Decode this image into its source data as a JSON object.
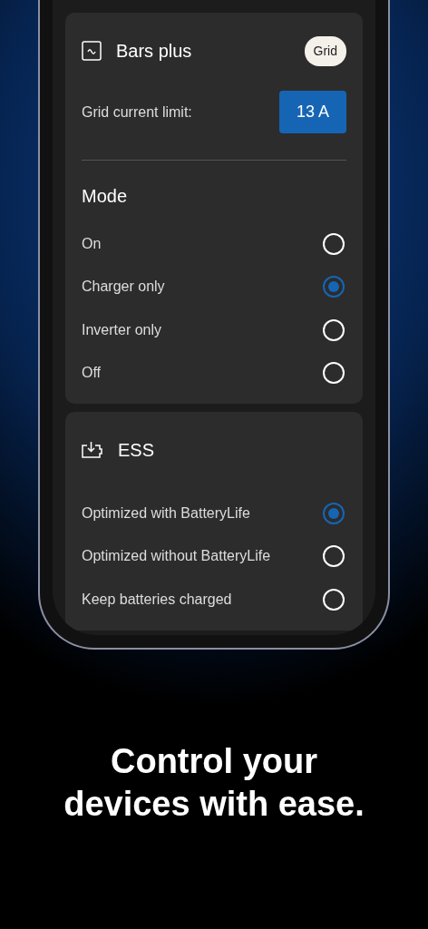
{
  "device": {
    "title": "Bars plus",
    "tag": "Grid",
    "limit_label": "Grid current limit:",
    "limit_value": "13 A"
  },
  "mode": {
    "title": "Mode",
    "options": [
      {
        "label": "On",
        "selected": false
      },
      {
        "label": "Charger only",
        "selected": true
      },
      {
        "label": "Inverter only",
        "selected": false
      },
      {
        "label": "Off",
        "selected": false
      }
    ]
  },
  "ess": {
    "title": "ESS",
    "options": [
      {
        "label": "Optimized with BatteryLife",
        "selected": true
      },
      {
        "label": "Optimized without BatteryLife",
        "selected": false
      },
      {
        "label": "Keep batteries charged",
        "selected": false
      }
    ]
  },
  "caption": "Control your devices with ease."
}
